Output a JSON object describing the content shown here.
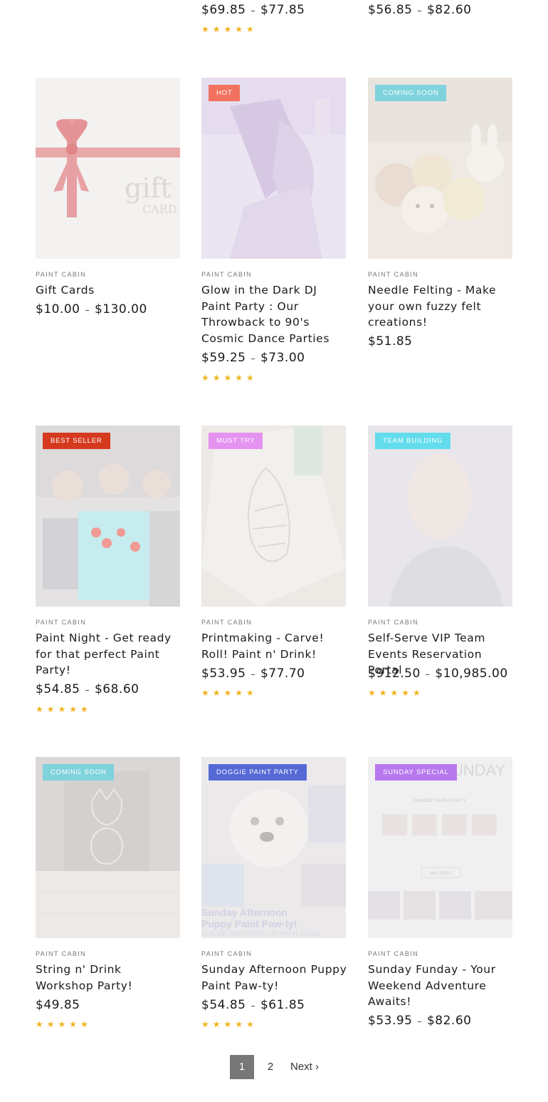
{
  "top_row": [
    {
      "price_from": "$69.85",
      "price_to": "$77.85",
      "rating": "★★★★★"
    },
    {
      "price_from": "$56.85",
      "price_to": "$82.60"
    }
  ],
  "products": [
    {
      "badge": "",
      "vendor": "PAINT CABIN",
      "title": "Gift Cards",
      "price_from": "$10.00",
      "price_to": "$130.00",
      "rating": "",
      "image_text_1": "gift",
      "image_text_2": "CARD"
    },
    {
      "badge": "HOT",
      "badge_color": "#f2725f",
      "vendor": "PAINT CABIN",
      "title": "Glow in the Dark DJ Paint Party : Our Throwback to 90's Cosmic Dance Parties",
      "price_from": "$59.25",
      "price_to": "$73.00",
      "rating": "★★★★★"
    },
    {
      "badge": "COMING SOON",
      "badge_color": "#7fd3dc",
      "vendor": "PAINT CABIN",
      "title": "Needle Felting - Make your own fuzzy felt creations!",
      "price_from": "$51.85",
      "price_to": "",
      "rating": ""
    },
    {
      "badge": "BEST SELLER",
      "badge_color": "#d53a1e",
      "vendor": "PAINT CABIN",
      "title": "Paint Night - Get ready for that perfect Paint Party!",
      "price_from": "$54.85",
      "price_to": "$68.60",
      "rating": "★★★★★"
    },
    {
      "badge": "MUST TRY",
      "badge_color": "#e493f0",
      "vendor": "PAINT CABIN",
      "title": "Printmaking - Carve! Roll! Paint n' Drink!",
      "price_from": "$53.95",
      "price_to": "$77.70",
      "rating": "★★★★★"
    },
    {
      "badge": "TEAM BUILDING",
      "badge_color": "#63dcec",
      "vendor": "PAINT CABIN",
      "title": "Self-Serve VIP Team Events Reservation Portal",
      "price_from": "$912.50",
      "price_to": "$10,985.00",
      "rating": "★★★★★"
    },
    {
      "badge": "COMING SOON",
      "badge_color": "#7fd3dc",
      "vendor": "PAINT CABIN",
      "title": "String n' Drink Workshop Party!",
      "price_from": "$49.85",
      "price_to": "",
      "rating": "★★★★★"
    },
    {
      "badge": "DOGGIE PAINT PARTY",
      "badge_color": "#5569d6",
      "vendor": "PAINT CABIN",
      "title": "Sunday Afternoon Puppy Paint Paw-ty!",
      "price_from": "$54.85",
      "price_to": "$61.85",
      "rating": "★★★★★",
      "image_text_1": "Sunday Afternoon",
      "image_text_2": "Puppy Paint Paw-ty!",
      "image_text_3": "DOGGIE PAINT PARTY AT PAINT CABIN"
    },
    {
      "badge": "SUNDAY SPECIAL",
      "badge_color": "#b778ee",
      "vendor": "PAINT CABIN",
      "title": "Sunday Funday - Your Weekend Adventure Awaits!",
      "price_from": "$53.95",
      "price_to": "$82.60",
      "rating": "",
      "image_text_1": "SUNDAY FUNDAY",
      "image_text_2": "CHOOSE YOUR ACTIVITY",
      "image_text_3": "INCLUDES"
    }
  ],
  "pagination": {
    "current": "1",
    "page2": "2",
    "next": "Next ›"
  },
  "colors": {
    "star": "#f0b41d",
    "active_page": "#777777"
  }
}
